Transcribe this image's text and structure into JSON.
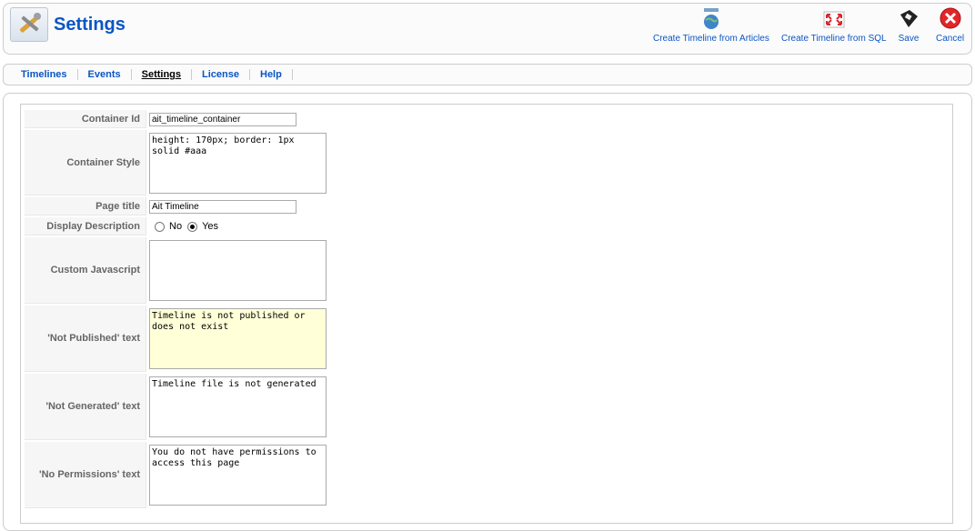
{
  "header": {
    "title": "Settings",
    "buttons": [
      {
        "label": "Create Timeline from Articles",
        "icon": "globe-icon"
      },
      {
        "label": "Create Timeline from SQL",
        "icon": "expand-icon"
      },
      {
        "label": "Save",
        "icon": "floppy-disk-icon"
      },
      {
        "label": "Cancel",
        "icon": "cancel-icon"
      }
    ]
  },
  "submenu": {
    "items": [
      "Timelines",
      "Events",
      "Settings",
      "License",
      "Help"
    ],
    "active": "Settings"
  },
  "form": {
    "container_id": {
      "label": "Container Id",
      "value": "ait_timeline_container"
    },
    "container_style": {
      "label": "Container Style",
      "value": "height: 170px; border: 1px solid #aaa"
    },
    "page_title": {
      "label": "Page title",
      "value": "Ait Timeline"
    },
    "display_description": {
      "label": "Display Description",
      "options": [
        "No",
        "Yes"
      ],
      "selected": "Yes"
    },
    "custom_javascript": {
      "label": "Custom Javascript",
      "value": ""
    },
    "not_published": {
      "label": "'Not Published' text",
      "value": "Timeline is not published or does not exist"
    },
    "not_generated": {
      "label": "'Not Generated' text",
      "value": "Timeline file is not generated"
    },
    "no_permissions": {
      "label": "'No Permissions' text",
      "value": "You do not have permissions to access this page"
    }
  },
  "colors": {
    "accent": "#0b55c4",
    "highlight_field": "#ffffd8"
  }
}
